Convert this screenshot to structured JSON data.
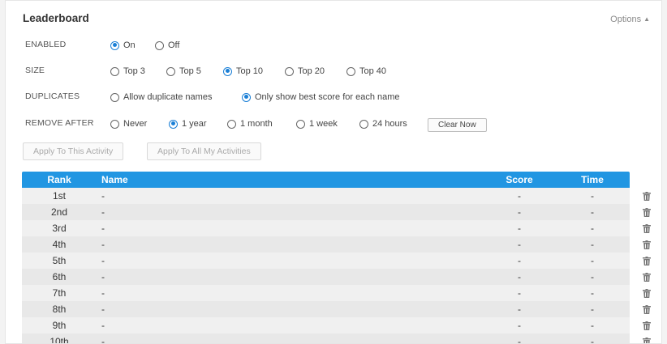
{
  "header": {
    "title": "Leaderboard",
    "options_label": "Options"
  },
  "settings": {
    "enabled": {
      "label": "ENABLED",
      "options": [
        "On",
        "Off"
      ],
      "selected": "On"
    },
    "size": {
      "label": "SIZE",
      "options": [
        "Top 3",
        "Top 5",
        "Top 10",
        "Top 20",
        "Top 40"
      ],
      "selected": "Top 10"
    },
    "duplicates": {
      "label": "DUPLICATES",
      "options": [
        "Allow duplicate names",
        "Only show best score for each name"
      ],
      "selected": "Only show best score for each name"
    },
    "remove_after": {
      "label": "REMOVE AFTER",
      "options": [
        "Never",
        "1 year",
        "1 month",
        "1 week",
        "24 hours"
      ],
      "selected": "1 year",
      "clear_button": "Clear Now"
    }
  },
  "actions": {
    "apply_this": "Apply To This Activity",
    "apply_all": "Apply To All My Activities"
  },
  "table": {
    "columns": {
      "rank": "Rank",
      "name": "Name",
      "score": "Score",
      "time": "Time"
    },
    "rows": [
      {
        "rank": "1st",
        "name": "-",
        "score": "-",
        "time": "-"
      },
      {
        "rank": "2nd",
        "name": "-",
        "score": "-",
        "time": "-"
      },
      {
        "rank": "3rd",
        "name": "-",
        "score": "-",
        "time": "-"
      },
      {
        "rank": "4th",
        "name": "-",
        "score": "-",
        "time": "-"
      },
      {
        "rank": "5th",
        "name": "-",
        "score": "-",
        "time": "-"
      },
      {
        "rank": "6th",
        "name": "-",
        "score": "-",
        "time": "-"
      },
      {
        "rank": "7th",
        "name": "-",
        "score": "-",
        "time": "-"
      },
      {
        "rank": "8th",
        "name": "-",
        "score": "-",
        "time": "-"
      },
      {
        "rank": "9th",
        "name": "-",
        "score": "-",
        "time": "-"
      },
      {
        "rank": "10th",
        "name": "-",
        "score": "-",
        "time": "-"
      }
    ],
    "row_icon": "trash-icon"
  },
  "colors": {
    "accent": "#2196e2",
    "radio_checked": "#1a7fd6"
  }
}
